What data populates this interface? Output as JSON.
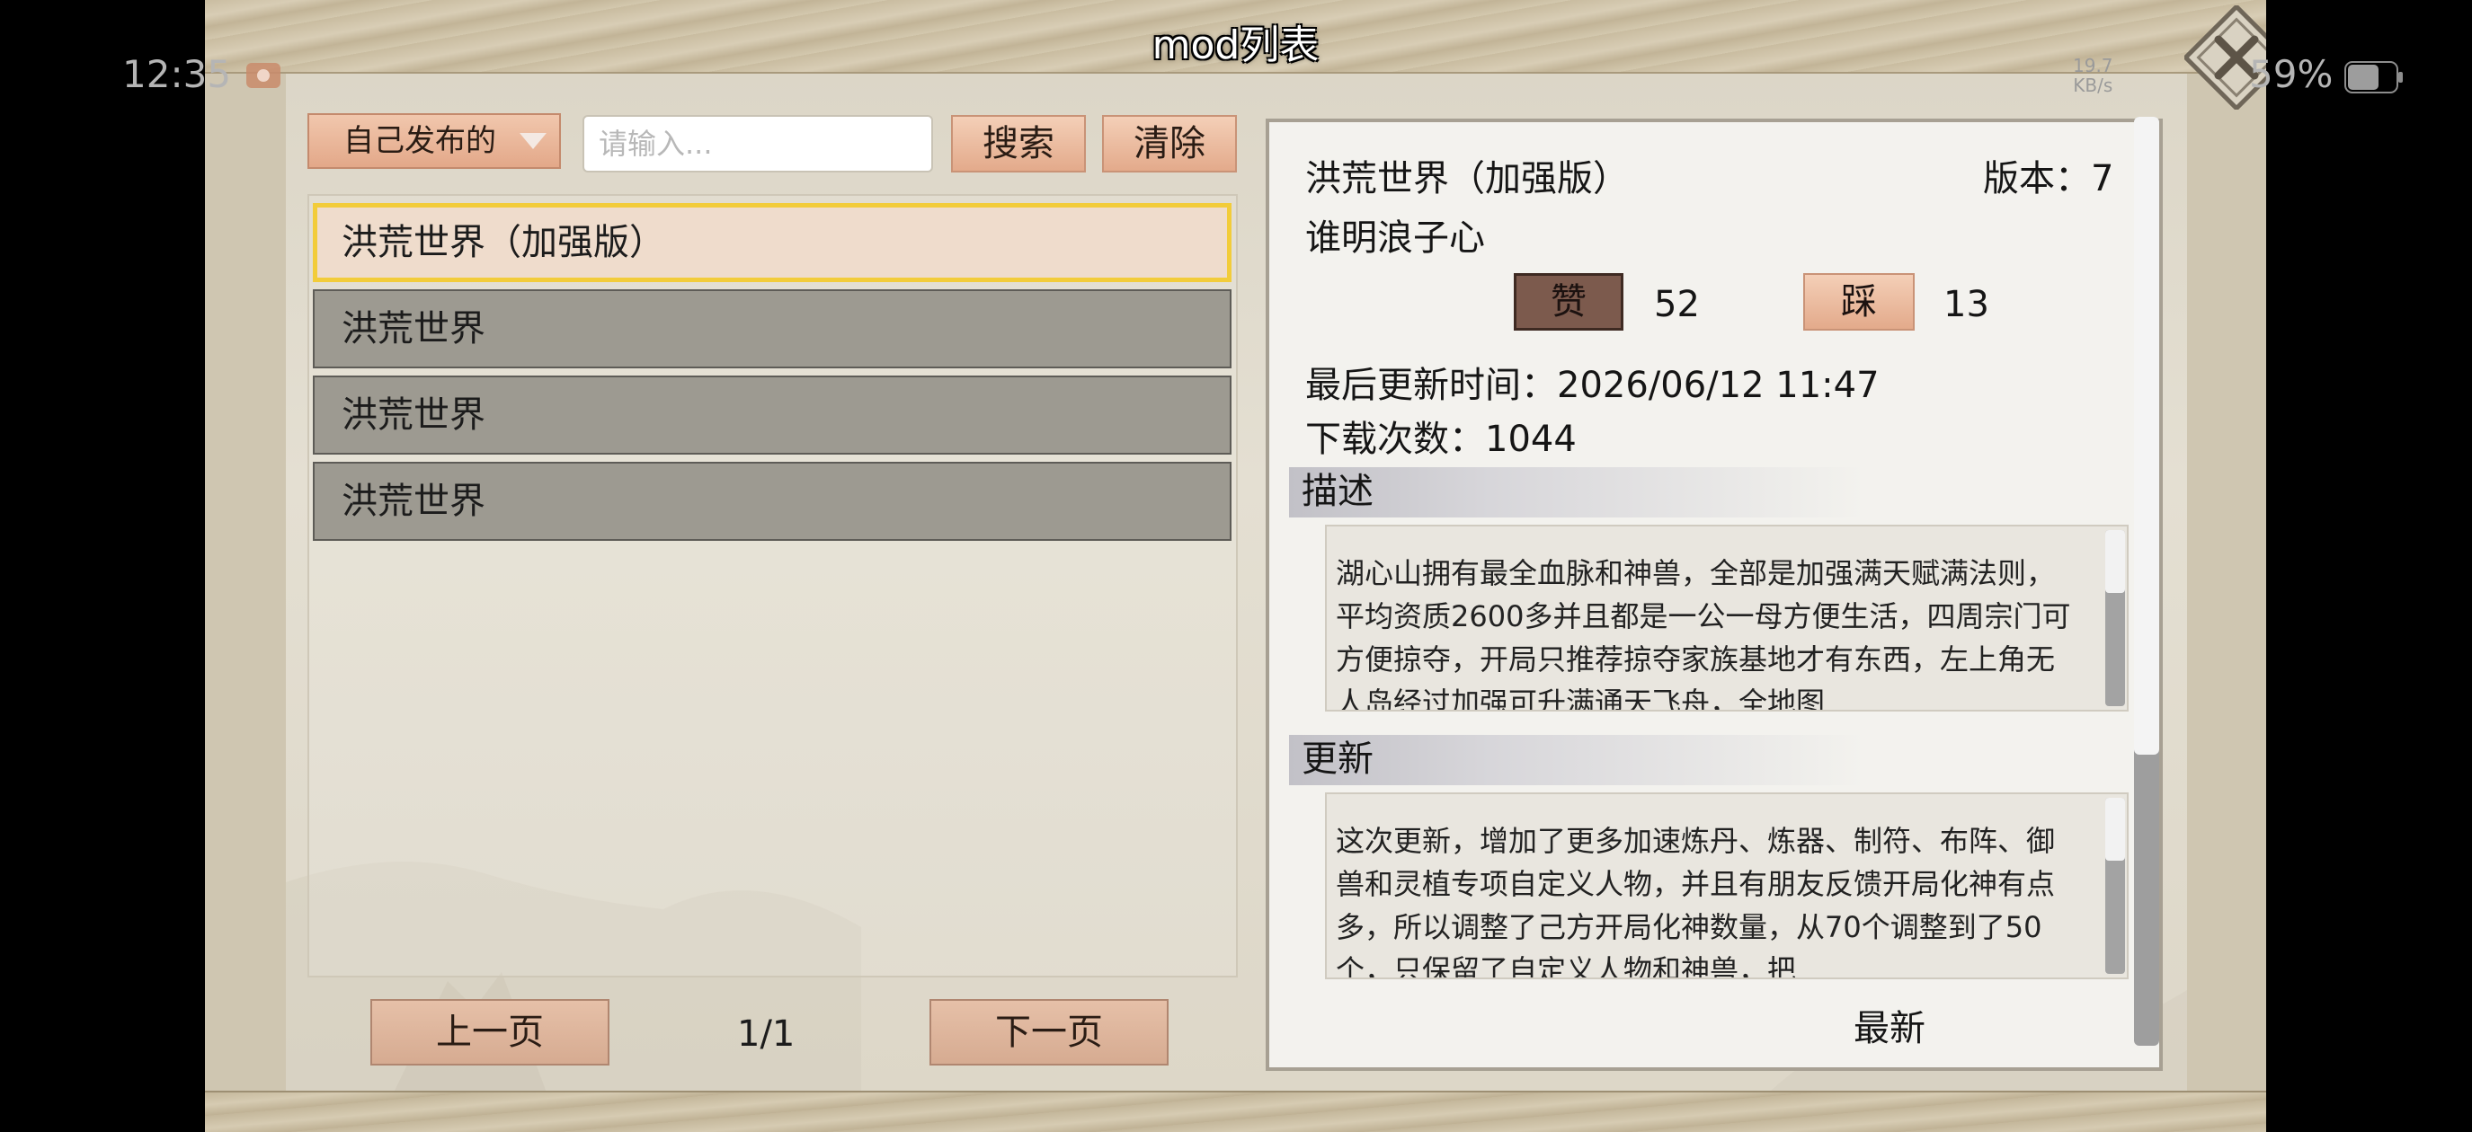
{
  "status_bar": {
    "time": "12:35",
    "net_speed_value": "19.7",
    "net_speed_unit": "KB/s",
    "battery_percent": "59%"
  },
  "header": {
    "title": "mod列表"
  },
  "filter": {
    "dropdown_selected": "自己发布的",
    "search_placeholder": "请输入...",
    "search_label": "搜索",
    "clear_label": "清除"
  },
  "mod_list": {
    "items": [
      {
        "name": "洪荒世界（加强版）",
        "selected": true
      },
      {
        "name": "洪荒世界",
        "selected": false
      },
      {
        "name": "洪荒世界",
        "selected": false
      },
      {
        "name": "洪荒世界",
        "selected": false
      }
    ]
  },
  "pagination": {
    "prev_label": "上一页",
    "page": "1/1",
    "next_label": "下一页"
  },
  "detail": {
    "name": "洪荒世界（加强版）",
    "version_label": "版本：7",
    "author": "谁明浪子心",
    "like_label": "赞",
    "like_count": "52",
    "dislike_label": "踩",
    "dislike_count": "13",
    "updated": "最后更新时间：2026/06/12 11:47",
    "downloads": "下载次数：1044",
    "description_heading": "描述",
    "description_text": "湖心山拥有最全血脉和神兽，全部是加强满天赋满法则，平均资质2600多并且都是一公一母方便生活，四周宗门可方便掠夺，开局只推荐掠夺家族基地才有东西，左上角无人岛经过加强可升满通天飞舟，全地图",
    "update_heading": "更新",
    "update_text": "这次更新，增加了更多加速炼丹、炼器、制符、布阵、御兽和灵植专项自定义人物，并且有朋友反馈开局化神有点多，所以调整了己方开局化神数量，从70个调整到了50个，只保留了自定义人物和神兽，把",
    "latest_label": "最新"
  },
  "colors": {
    "peach_button": "#e3aa8b",
    "selected_border": "#f2cc3a",
    "list_item_bg": "#9d9a91",
    "like_active": "#7c5a4d"
  },
  "icons": {
    "close": "close-x-icon",
    "dropdown": "triangle-down-icon",
    "recorder": "screen-record-icon",
    "battery": "battery-icon"
  }
}
